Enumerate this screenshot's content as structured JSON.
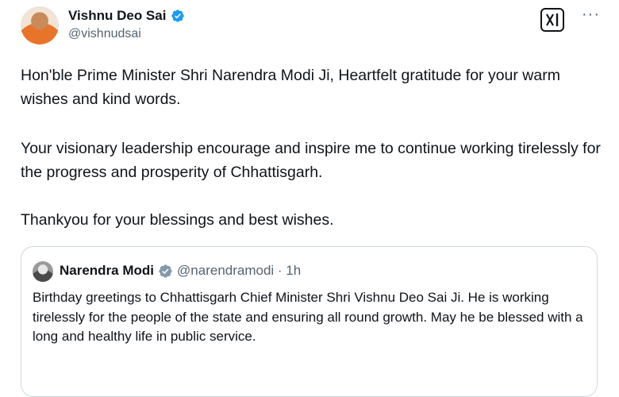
{
  "author": {
    "display_name": "Vishnu Deo Sai",
    "handle": "@vishnudsai"
  },
  "tweet": {
    "paragraphs": [
      "Hon'ble Prime Minister Shri Narendra Modi Ji, Heartfelt gratitude for your warm wishes and kind words.",
      "Your visionary leadership encourage and inspire me to continue working tirelessly for the progress and prosperity of Chhattisgarh.",
      "Thankyou for your blessings and best wishes."
    ]
  },
  "quoted": {
    "display_name": "Narendra Modi",
    "meta": "@narendramodi · 1h",
    "text": "Birthday greetings to Chhattisgarh Chief Minister Shri Vishnu Deo Sai Ji. He is working tirelessly for the people of the state and ensuring all round growth. May he be blessed with a long and healthy life in public service."
  },
  "icons": {
    "verified": "verified-badge-icon",
    "grok": "grok-icon",
    "more": "more-icon"
  },
  "colors": {
    "verified_blue": "#1d9bf0",
    "secondary_text": "#536471",
    "border": "#cfd9de"
  }
}
